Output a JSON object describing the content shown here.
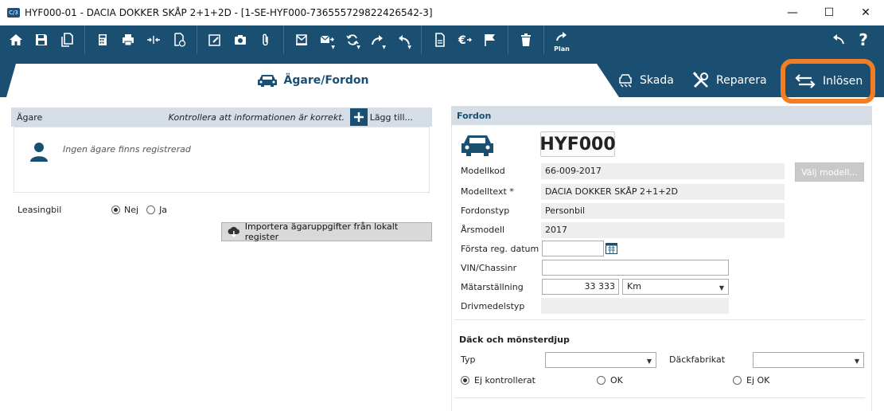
{
  "window": {
    "app_icon": "C/3",
    "title": "HYF000-01 - DACIA DOKKER SKÅP 2+1+2D - [1-SE-HYF000-736555729822426542-3]",
    "minimize": "—",
    "maximize": "☐",
    "close": "✕"
  },
  "toolbar": {
    "plan_label": "Plan",
    "help": "?"
  },
  "tabs": {
    "active": "Ägare/Fordon",
    "skada": "Skada",
    "reparera": "Reparera",
    "inlosen": "Inlösen",
    "highlight_color": "#f27d22"
  },
  "owner": {
    "header": "Ägare",
    "hint": "Kontrollera att informationen är korrekt.",
    "add_label": "Lägg till...",
    "empty_text": "Ingen ägare finns registrerad",
    "leasing_label": "Leasingbil",
    "leasing_no": "Nej",
    "leasing_yes": "Ja",
    "import_button": "Importera ägaruppgifter från lokalt register"
  },
  "vehicle": {
    "header": "Fordon",
    "reg_number": "HYF000",
    "choose_model_button": "Välj modell...",
    "fields": {
      "modellkod_label": "Modellkod",
      "modellkod_value": "66-009-2017",
      "modelltext_label": "Modelltext *",
      "modelltext_value": "DACIA DOKKER SKÅP 2+1+2D",
      "fordonstyp_label": "Fordonstyp",
      "fordonstyp_value": "Personbil",
      "arsmodell_label": "Årsmodell",
      "arsmodell_value": "2017",
      "forsta_reg_label": "Första reg. datum",
      "forsta_reg_value": "",
      "vin_label": "VIN/Chassinr",
      "vin_value": "",
      "matar_label": "Mätarställning",
      "matar_value": "33 333",
      "matar_unit": "Km",
      "drivmedel_label": "Drivmedelstyp",
      "drivmedel_value": ""
    }
  },
  "tires": {
    "header": "Däck och mönsterdjup",
    "typ_label": "Typ",
    "typ_value": "",
    "fabrikat_label": "Däckfabrikat",
    "fabrikat_value": "",
    "opt_ej_kontrollerat": "Ej kontrollerat",
    "opt_ok": "OK",
    "opt_ej_ok": "Ej OK"
  },
  "colors": {
    "toolbar_bg": "#1b4f72",
    "panel_header_bg": "#d5dde7",
    "accent_orange": "#f27d22"
  }
}
